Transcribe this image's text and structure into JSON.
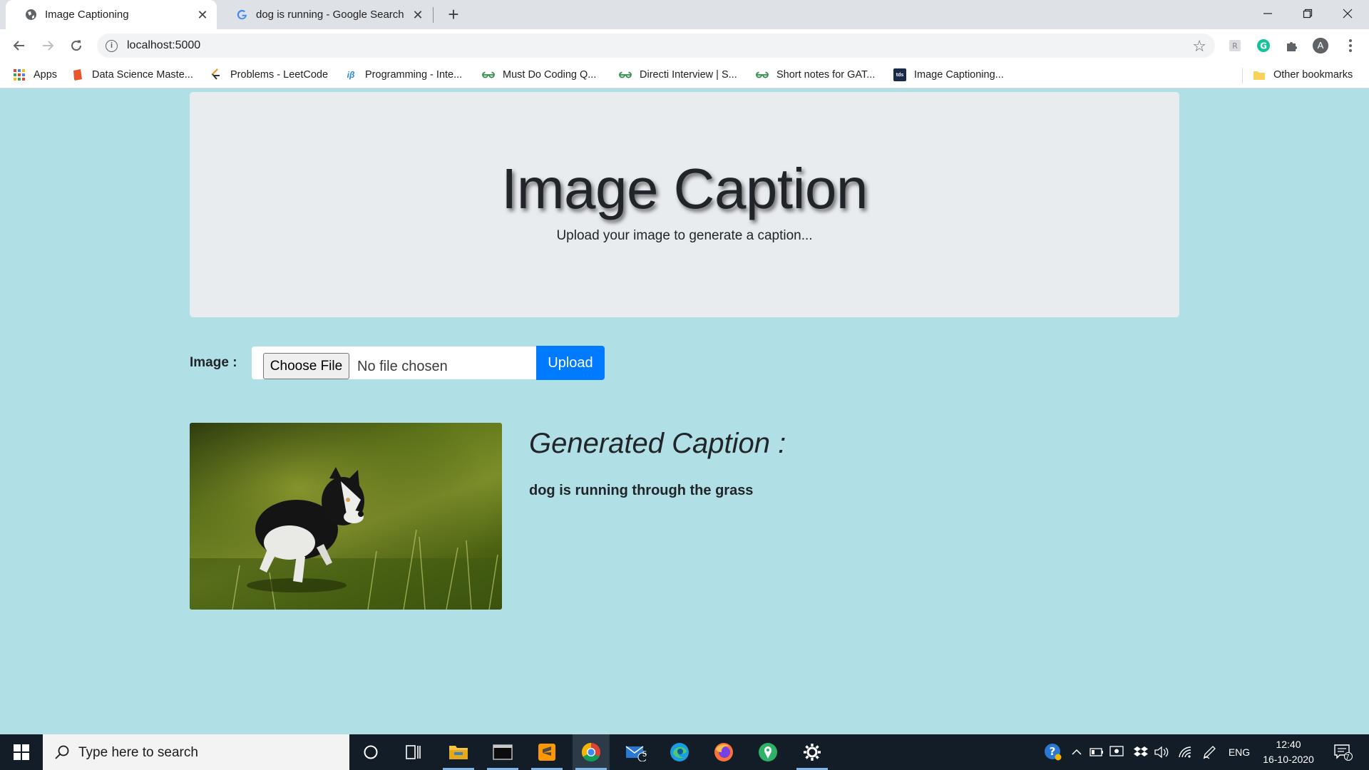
{
  "browser": {
    "tabs": [
      {
        "title": "Image Captioning",
        "active": true
      },
      {
        "title": "dog is running - Google Search",
        "active": false
      }
    ],
    "url": "localhost:5000",
    "profile_initial": "A",
    "bookmarks": [
      {
        "label": "Apps",
        "icon": "apps-grid-icon"
      },
      {
        "label": "Data Science Maste...",
        "icon": "book-icon"
      },
      {
        "label": "Problems - LeetCode",
        "icon": "leetcode-icon"
      },
      {
        "label": "Programming - Inte...",
        "icon": "interviewbit-icon"
      },
      {
        "label": "Must Do Coding Q...",
        "icon": "gfg-icon"
      },
      {
        "label": "Directi Interview | S...",
        "icon": "gfg-icon"
      },
      {
        "label": "Short notes for GAT...",
        "icon": "gfg-icon"
      },
      {
        "label": "Image Captioning...",
        "icon": "tds-icon",
        "icon_text": "tds"
      }
    ],
    "other_bookmarks": "Other bookmarks"
  },
  "page": {
    "title": "Image Caption",
    "subtitle": "Upload your image to generate a caption...",
    "form": {
      "label": "Image :",
      "choose_file": "Choose File",
      "no_file": "No file chosen",
      "upload": "Upload"
    },
    "image_subject": "dog-running-on-grass",
    "caption_heading": "Generated Caption :",
    "caption_text": "dog is running through the grass"
  },
  "taskbar": {
    "search_placeholder": "Type here to search",
    "mail_badge": "5",
    "language": "ENG",
    "time": "12:40",
    "date": "16-10-2020",
    "notification_count": "7"
  },
  "colors": {
    "page_background": "#b0dfe5",
    "jumbotron": "#e9ecef",
    "primary_button": "#007bff",
    "taskbar": "#121d28"
  }
}
